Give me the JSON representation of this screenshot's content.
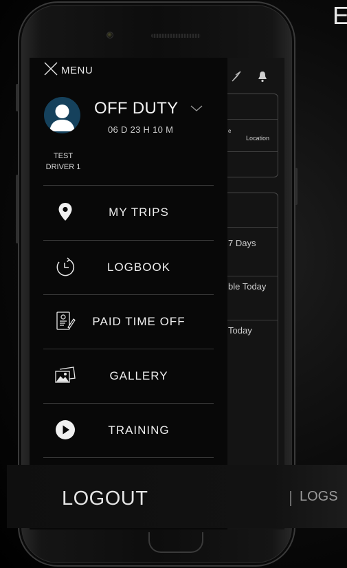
{
  "corner_letter": "E",
  "menu": {
    "close_label": "MENU",
    "driver_name_line1": "TEST",
    "driver_name_line2": "DRIVER 1",
    "duty_status": "OFF DUTY",
    "duty_timer": "06 D 23 H 10 M",
    "items": [
      {
        "label": "MY TRIPS",
        "icon": "location-pin-icon"
      },
      {
        "label": "LOGBOOK",
        "icon": "history-clock-icon"
      },
      {
        "label": "PAID TIME OFF",
        "icon": "document-icon"
      },
      {
        "label": "GALLERY",
        "icon": "gallery-icon"
      },
      {
        "label": "TRAINING",
        "icon": "play-circle-icon"
      }
    ],
    "logout_label": "LOGOUT"
  },
  "background_app": {
    "location_label": "Location",
    "partial_e": "e",
    "days_label": "7 Days",
    "available_label": "ble Today",
    "today_label": "Today",
    "logs_label": "LOGS"
  },
  "colors": {
    "avatar_bg": "#15415c",
    "drawer_bg": "#080808",
    "text": "#eeeeee"
  }
}
